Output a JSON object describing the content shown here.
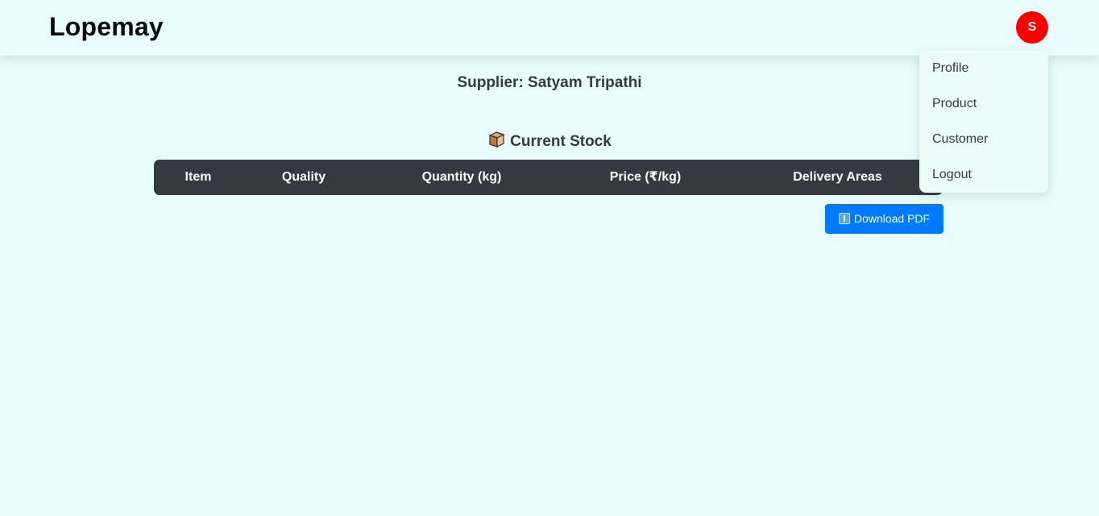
{
  "navbar": {
    "brand": "Lopemay",
    "avatar_initial": "S"
  },
  "dropdown": {
    "items": [
      {
        "label": "Profile"
      },
      {
        "label": "Product"
      },
      {
        "label": "Customer"
      },
      {
        "label": "Logout"
      }
    ]
  },
  "page": {
    "supplier_heading": "Supplier: Satyam Tripathi",
    "stock_icon": "package-icon",
    "stock_title": "Current Stock"
  },
  "table": {
    "columns": [
      "Item",
      "Quality",
      "Quantity (kg)",
      "Price (₹/kg)",
      "Delivery Areas"
    ],
    "rows": []
  },
  "actions": {
    "download_icon": "download-icon",
    "download_label": "Download PDF"
  },
  "colors": {
    "background": "#e8fdfb",
    "table_header": "#343a40",
    "avatar": "#ff0000",
    "primary_button": "#007bff"
  }
}
